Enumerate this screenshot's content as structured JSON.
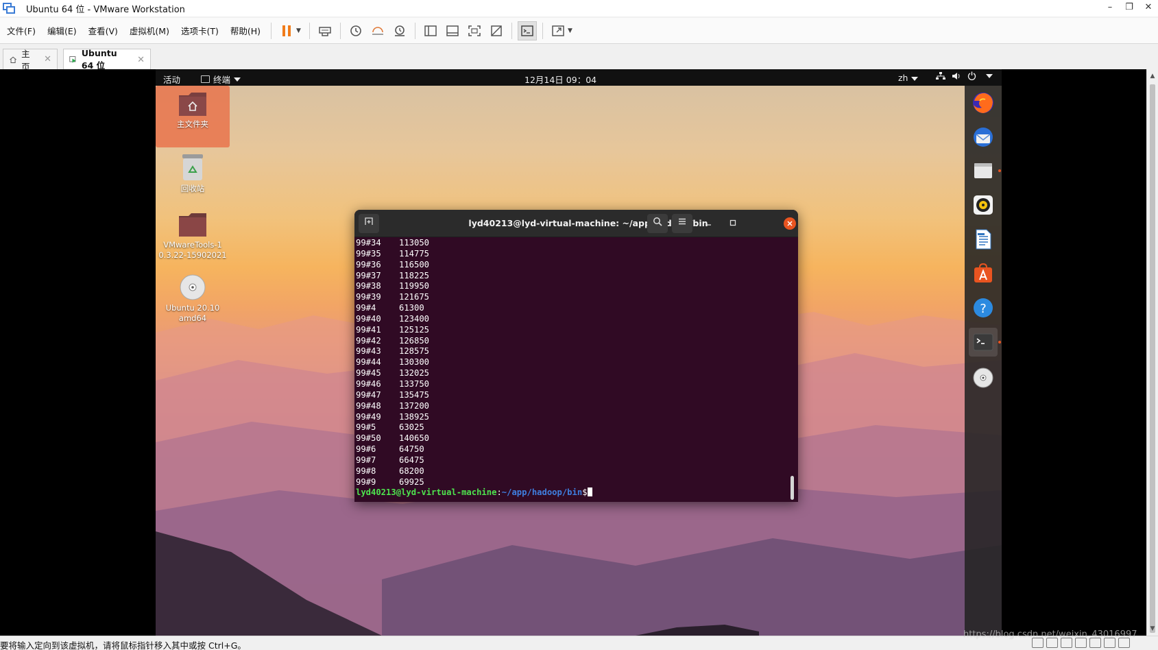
{
  "window": {
    "title": "Ubuntu 64 位 - VMware Workstation",
    "controls": [
      "–",
      "❐",
      "✕"
    ]
  },
  "menubar": {
    "items": [
      "文件(F)",
      "编辑(E)",
      "查看(V)",
      "虚拟机(M)",
      "选项卡(T)",
      "帮助(H)"
    ]
  },
  "tabs": [
    {
      "label": "主页"
    },
    {
      "label": "Ubuntu 64 位"
    }
  ],
  "ubuntu": {
    "activities": "活动",
    "app_menu": "终端",
    "clock": "12月14日  09：04",
    "lang": "zh",
    "desktop_icons": [
      {
        "label": "主文件夹",
        "icon": "home-folder-icon"
      },
      {
        "label": "回收站",
        "icon": "trash-icon"
      },
      {
        "label": "VMwareTools-10.3.22-15902021",
        "line1": "VMwareTools-1",
        "line2": "0.3.22-15902021",
        "icon": "folder-icon"
      },
      {
        "label": "Ubuntu 20.10 amd64",
        "line1": "Ubuntu 20.10",
        "line2": "amd64",
        "icon": "disc-icon"
      }
    ],
    "dock": [
      "firefox-icon",
      "thunderbird-icon",
      "files-icon",
      "rhythmbox-icon",
      "writer-icon",
      "software-icon",
      "help-icon",
      "terminal-icon",
      "disc-icon"
    ],
    "accent": "#e95420"
  },
  "terminal": {
    "title": "lyd40213@lyd-virtual-machine: ~/app/hadoop/bin",
    "lines": [
      [
        "99#34",
        "113050"
      ],
      [
        "99#35",
        "114775"
      ],
      [
        "99#36",
        "116500"
      ],
      [
        "99#37",
        "118225"
      ],
      [
        "99#38",
        "119950"
      ],
      [
        "99#39",
        "121675"
      ],
      [
        "99#4",
        "61300"
      ],
      [
        "99#40",
        "123400"
      ],
      [
        "99#41",
        "125125"
      ],
      [
        "99#42",
        "126850"
      ],
      [
        "99#43",
        "128575"
      ],
      [
        "99#44",
        "130300"
      ],
      [
        "99#45",
        "132025"
      ],
      [
        "99#46",
        "133750"
      ],
      [
        "99#47",
        "135475"
      ],
      [
        "99#48",
        "137200"
      ],
      [
        "99#49",
        "138925"
      ],
      [
        "99#5",
        "63025"
      ],
      [
        "99#50",
        "140650"
      ],
      [
        "99#6",
        "64750"
      ],
      [
        "99#7",
        "66475"
      ],
      [
        "99#8",
        "68200"
      ],
      [
        "99#9",
        "69925"
      ]
    ],
    "prompt_user": "lyd40213@lyd-virtual-machine",
    "prompt_sep": ":",
    "prompt_path": "~/app/hadoop/bin",
    "prompt_end": "$",
    "background": "#300a24"
  },
  "statusbar": {
    "message": "要将输入定向到该虚拟机，请将鼠标指针移入其中或按 Ctrl+G。",
    "watermark": "https://blog.csdn.net/weixin_43016997"
  }
}
